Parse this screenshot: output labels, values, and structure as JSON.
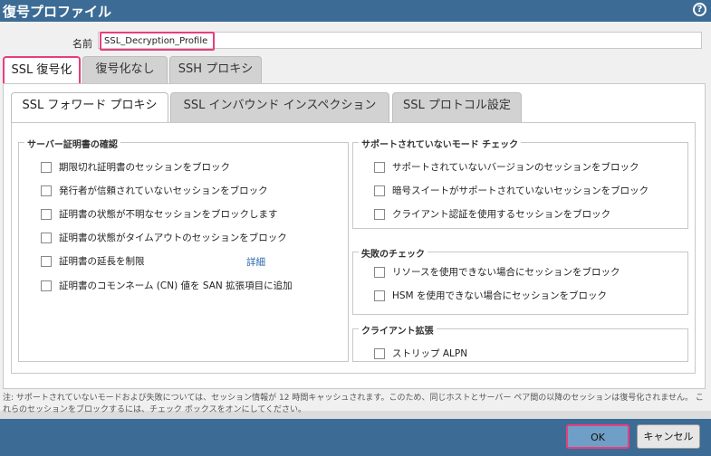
{
  "dialog": {
    "title": "復号プロファイル",
    "help_icon": "?"
  },
  "name_field": {
    "label": "名前",
    "value": "SSL_Decryption_Profile"
  },
  "outer_tabs": [
    "SSL 復号化",
    "復号化なし",
    "SSH プロキシ"
  ],
  "inner_tabs": [
    "SSL フォワード プロキシ",
    "SSL インバウンド インスペクション",
    "SSL プロトコル設定"
  ],
  "server_cert_checks": {
    "legend": "サーバー証明書の確認",
    "items": [
      "期限切れ証明書のセッションをブロック",
      "発行者が信頼されていないセッションをブロック",
      "証明書の状態が不明なセッションをブロックします",
      "証明書の状態がタイムアウトのセッションをブロック",
      "証明書の延長を制限",
      "証明書のコモンネーム (CN) 値を SAN 拡張項目に追加"
    ],
    "details_link": "詳細"
  },
  "unsupported_mode_checks": {
    "legend": "サポートされていないモード チェック",
    "items": [
      "サポートされていないバージョンのセッションをブロック",
      "暗号スイートがサポートされていないセッションをブロック",
      "クライアント認証を使用するセッションをブロック"
    ]
  },
  "failure_checks": {
    "legend": "失敗のチェック",
    "items": [
      "リソースを使用できない場合にセッションをブロック",
      "HSM を使用できない場合にセッションをブロック"
    ]
  },
  "client_extension": {
    "legend": "クライアント拡張",
    "items": [
      "ストリップ ALPN"
    ]
  },
  "note": "注: サポートされていないモードおよび失敗については、セッション情報が 12 時間キャッシュされます。このため、同じホストとサーバー ペア間の以降のセッションは復号化されません。 これらのセッションをブロックするには、チェック ボックスをオンにしてください。",
  "buttons": {
    "ok": "OK",
    "cancel": "キャンセル"
  },
  "colors": {
    "titlebar": "#3c6c95",
    "highlight": "#e83e7e",
    "ok_button": "#6f9fc6"
  }
}
